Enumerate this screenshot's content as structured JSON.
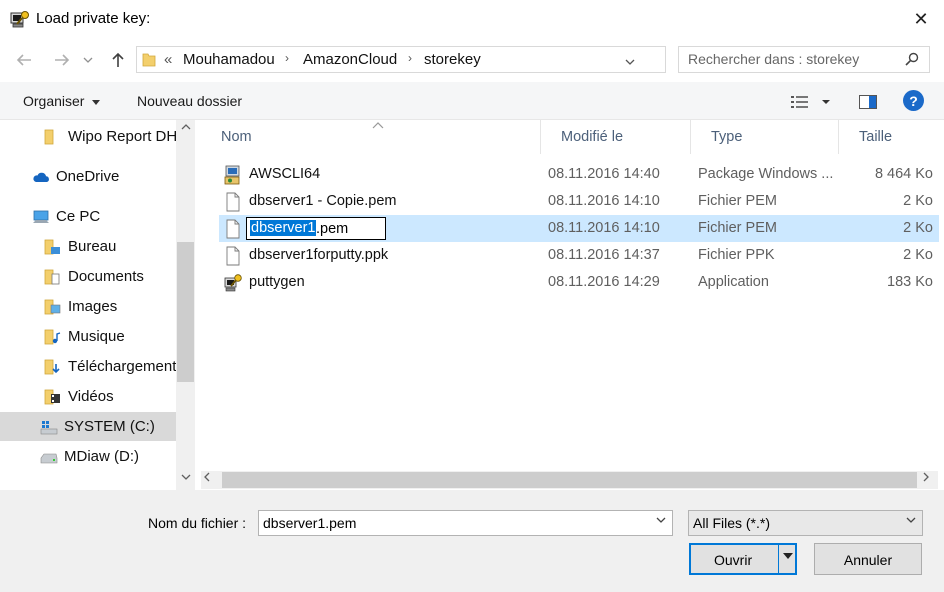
{
  "window": {
    "title": "Load private key:",
    "close_glyph": "✕"
  },
  "address": {
    "overflow": "«",
    "breadcrumbs": [
      "Mouhamadou",
      "AmazonCloud",
      "storekey"
    ],
    "separator": "›"
  },
  "search": {
    "placeholder": "Rechercher dans : storekey"
  },
  "toolbar": {
    "organize": "Organiser",
    "new_folder": "Nouveau dossier",
    "help": "?"
  },
  "sidebar": {
    "items": [
      {
        "label": "Wipo Report DH",
        "icon": "folder-icon"
      },
      {
        "label": "OneDrive",
        "icon": "cloud-icon"
      },
      {
        "label": "Ce PC",
        "icon": "computer-icon"
      },
      {
        "label": "Bureau",
        "icon": "desktop-folder-icon"
      },
      {
        "label": "Documents",
        "icon": "documents-folder-icon"
      },
      {
        "label": "Images",
        "icon": "pictures-folder-icon"
      },
      {
        "label": "Musique",
        "icon": "music-folder-icon"
      },
      {
        "label": "Téléchargements",
        "icon": "downloads-folder-icon"
      },
      {
        "label": "Vidéos",
        "icon": "videos-folder-icon"
      },
      {
        "label": "SYSTEM (C:)",
        "icon": "system-drive-icon"
      },
      {
        "label": "MDiaw (D:)",
        "icon": "drive-icon"
      }
    ]
  },
  "columns": {
    "name": "Nom",
    "date": "Modifié le",
    "type": "Type",
    "size": "Taille"
  },
  "files": [
    {
      "name": "AWSCLI64",
      "date": "08.11.2016 14:40",
      "type": "Package Windows ...",
      "size": "8 464 Ko",
      "icon": "installer-package-icon"
    },
    {
      "name": "dbserver1 - Copie.pem",
      "date": "08.11.2016 14:10",
      "type": "Fichier PEM",
      "size": "2 Ko",
      "icon": "file-icon"
    },
    {
      "name": "dbserver1.pem",
      "date": "08.11.2016 14:10",
      "type": "Fichier PEM",
      "size": "2 Ko",
      "icon": "file-icon",
      "rename_selected": "dbserver1",
      "rename_rest": ".pem"
    },
    {
      "name": "dbserver1forputty.ppk",
      "date": "08.11.2016 14:37",
      "type": "Fichier PPK",
      "size": "2 Ko",
      "icon": "file-icon"
    },
    {
      "name": "puttygen",
      "date": "08.11.2016 14:29",
      "type": "Application",
      "size": "183 Ko",
      "icon": "puttygen-app-icon"
    }
  ],
  "bottom": {
    "filename_label": "Nom du fichier :",
    "filename_value": "dbserver1.pem",
    "filter_value": "All Files (*.*)",
    "open_label": "Ouvrir",
    "cancel_label": "Annuler"
  }
}
